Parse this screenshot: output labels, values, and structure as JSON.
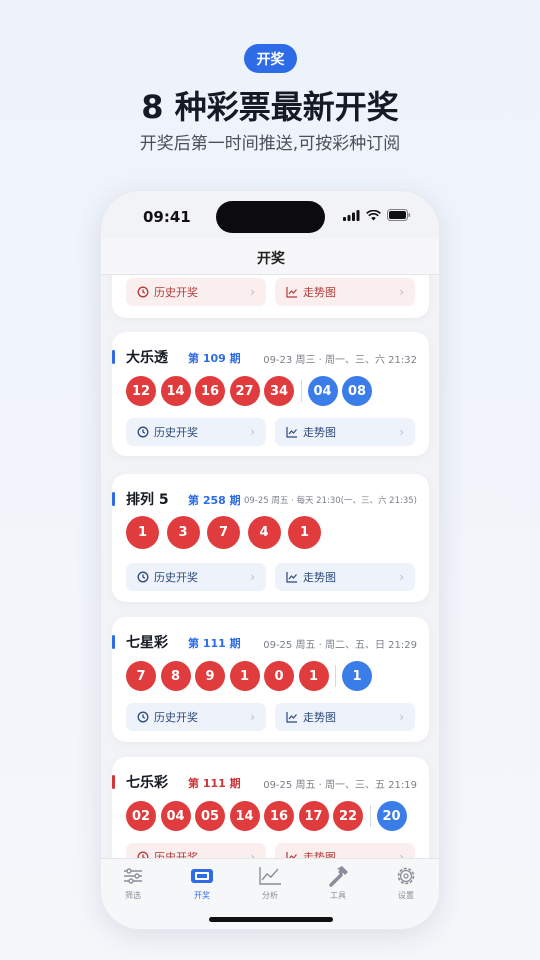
{
  "promo": {
    "badge": "开奖",
    "headline": "8 种彩票最新开奖",
    "subline": "开奖后第一时间推送,可按彩种订阅"
  },
  "status_bar": {
    "time": "09:41"
  },
  "nav": {
    "title": "开奖"
  },
  "colors": {
    "accent": "#2d6ce6",
    "red_ball": "#e03c3e",
    "blue_ball": "#3a7de8"
  },
  "top_card": {
    "history_label": "历史开奖",
    "trend_label": "走势图"
  },
  "cards": [
    {
      "name": "大乐透",
      "issue": "第 109 期",
      "schedule": "09-23 周三 · 周一、三、六 21:32",
      "red": [
        "12",
        "14",
        "16",
        "27",
        "34"
      ],
      "blue": [
        "04",
        "08"
      ],
      "history_label": "历史开奖",
      "trend_label": "走势图"
    },
    {
      "name": "排列 5",
      "issue": "第 258 期",
      "schedule": "09-25 周五 · 每天 21:30(一、三、六 21:35)",
      "red": [
        "1",
        "3",
        "7",
        "4",
        "1"
      ],
      "blue": [],
      "history_label": "历史开奖",
      "trend_label": "走势图"
    },
    {
      "name": "七星彩",
      "issue": "第 111 期",
      "schedule": "09-25 周五 · 周二、五、日 21:29",
      "red": [
        "7",
        "8",
        "9",
        "1",
        "0",
        "1"
      ],
      "blue": [
        "1"
      ],
      "history_label": "历史开奖",
      "trend_label": "走势图"
    },
    {
      "name": "七乐彩",
      "issue": "第 111 期",
      "schedule": "09-25 周五 · 周一、三、五 21:19",
      "red": [
        "02",
        "04",
        "05",
        "14",
        "16",
        "17",
        "22"
      ],
      "blue": [
        "20"
      ],
      "history_label": "历史开奖",
      "trend_label": "走势图"
    }
  ],
  "tabs": [
    {
      "label": "筛选",
      "icon": "sliders-icon"
    },
    {
      "label": "开奖",
      "icon": "ticket-icon",
      "active": true
    },
    {
      "label": "分析",
      "icon": "chart-icon"
    },
    {
      "label": "工具",
      "icon": "hammer-icon"
    },
    {
      "label": "设置",
      "icon": "gear-icon"
    }
  ]
}
